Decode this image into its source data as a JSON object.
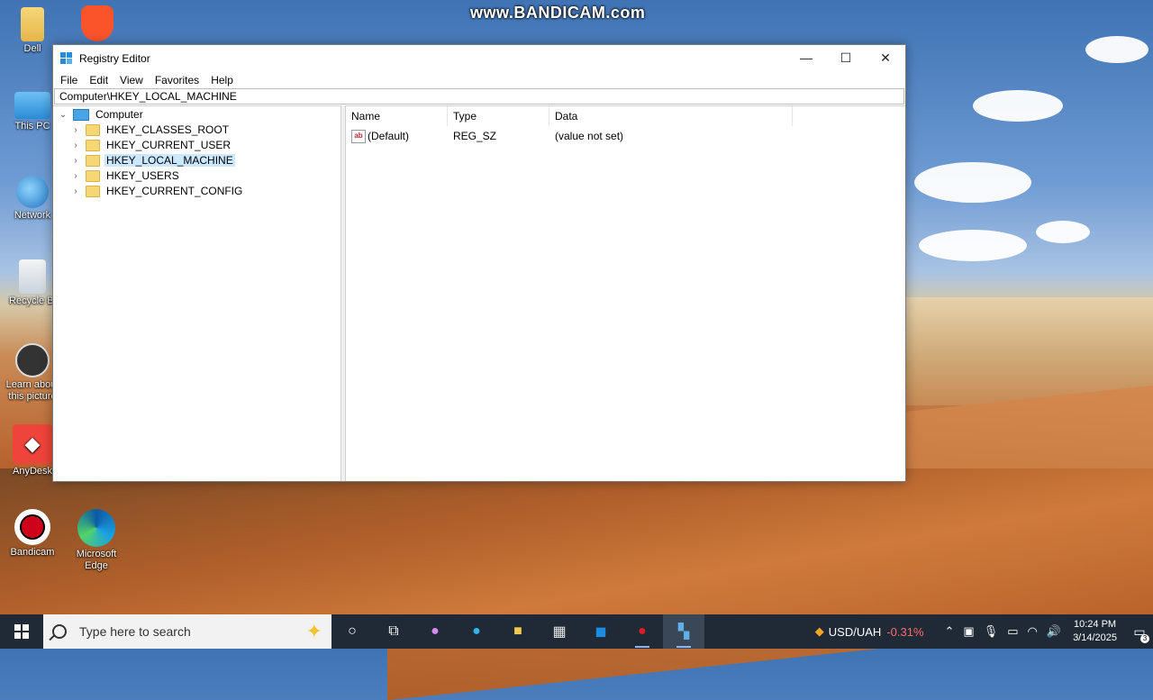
{
  "watermark": "www.BANDICAM.com",
  "desktop": {
    "icons": [
      {
        "label": "Dell"
      },
      {
        "label": ""
      },
      {
        "label": "This PC"
      },
      {
        "label": "Network"
      },
      {
        "label": "Recycle Bi"
      },
      {
        "label": "Learn about this picture"
      },
      {
        "label": "AnyDesk"
      },
      {
        "label": "Bandicam"
      },
      {
        "label": "Microsoft Edge"
      }
    ]
  },
  "window": {
    "title": "Registry Editor",
    "menu": [
      "File",
      "Edit",
      "View",
      "Favorites",
      "Help"
    ],
    "address": "Computer\\HKEY_LOCAL_MACHINE",
    "tree": {
      "root": "Computer",
      "children": [
        "HKEY_CLASSES_ROOT",
        "HKEY_CURRENT_USER",
        "HKEY_LOCAL_MACHINE",
        "HKEY_USERS",
        "HKEY_CURRENT_CONFIG"
      ],
      "selected": "HKEY_LOCAL_MACHINE"
    },
    "columns": [
      "Name",
      "Type",
      "Data"
    ],
    "rows": [
      {
        "name": "(Default)",
        "type": "REG_SZ",
        "data": "(value not set)"
      }
    ],
    "controls": {
      "minimize": "—",
      "maximize": "☐",
      "close": "✕"
    }
  },
  "taskbar": {
    "search_placeholder": "Type here to search",
    "currency": "USD/UAH",
    "currency_change": "-0.31%",
    "time": "10:24 PM",
    "date": "3/14/2025",
    "notification_count": "3"
  }
}
